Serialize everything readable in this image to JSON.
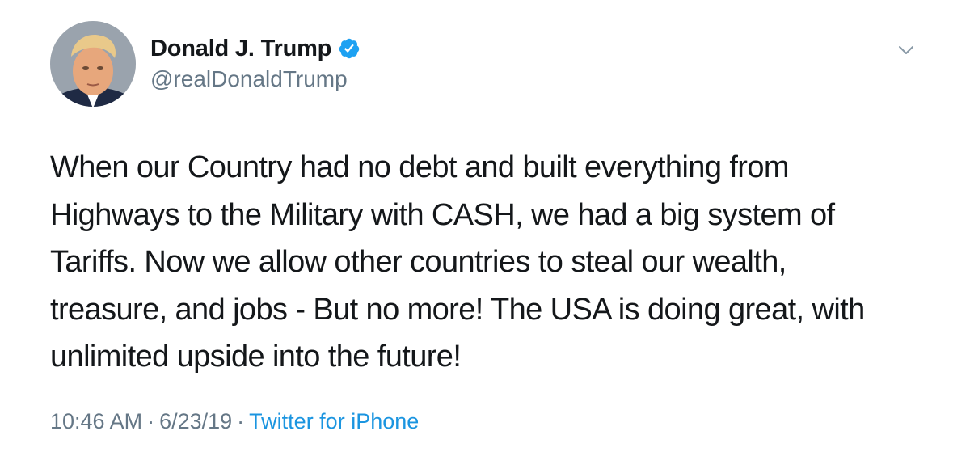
{
  "author": {
    "display_name": "Donald J. Trump",
    "handle": "@realDonaldTrump",
    "verified": true
  },
  "tweet": {
    "lines": [
      "When our Country had no debt and built everything from",
      "Highways to the Military with CASH, we had a big system of",
      "Tariffs. Now we allow other countries to steal our wealth,",
      "treasure, and jobs - But no more! The USA is doing great, with",
      "unlimited upside into the future!"
    ]
  },
  "meta": {
    "time": "10:46 AM",
    "separator": "·",
    "date": "6/23/19",
    "source": "Twitter for iPhone"
  },
  "icons": {
    "verified": "verified-badge-icon",
    "menu": "chevron-down-icon"
  },
  "colors": {
    "text": "#14171a",
    "secondary": "#657786",
    "link": "#1b95e0",
    "verified": "#1da1f2"
  }
}
